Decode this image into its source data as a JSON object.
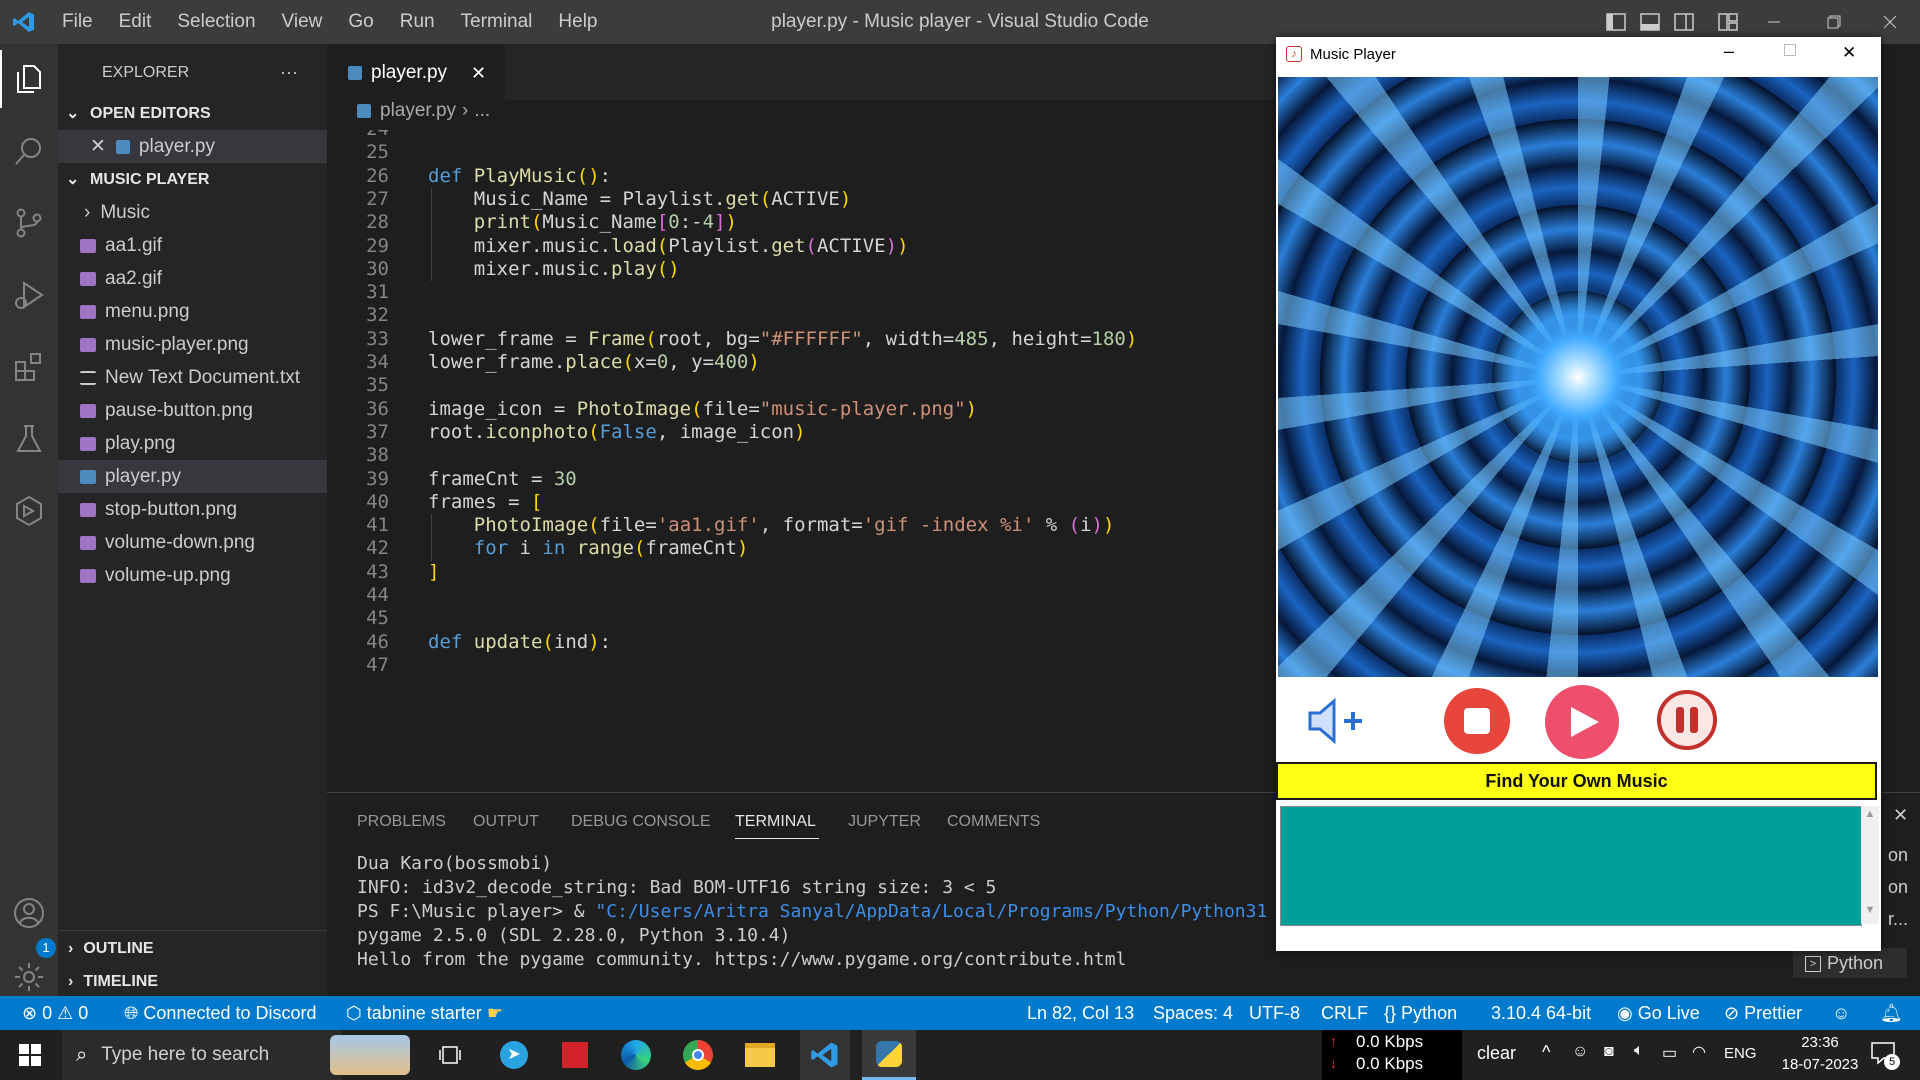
{
  "window_title": "player.py - Music player - Visual Studio Code",
  "menu": [
    "File",
    "Edit",
    "Selection",
    "View",
    "Go",
    "Run",
    "Terminal",
    "Help"
  ],
  "explorer": {
    "title": "EXPLORER",
    "more": "···",
    "open_editors_label": "OPEN EDITORS",
    "open_editor_file": "player.py",
    "folder_label": "MUSIC PLAYER",
    "subfolder": "Music",
    "files": [
      {
        "name": "aa1.gif",
        "kind": "image"
      },
      {
        "name": "aa2.gif",
        "kind": "image"
      },
      {
        "name": "menu.png",
        "kind": "image"
      },
      {
        "name": "music-player.png",
        "kind": "image"
      },
      {
        "name": "New Text Document.txt",
        "kind": "text"
      },
      {
        "name": "pause-button.png",
        "kind": "image"
      },
      {
        "name": "play.png",
        "kind": "image"
      },
      {
        "name": "player.py",
        "kind": "python"
      },
      {
        "name": "stop-button.png",
        "kind": "image"
      },
      {
        "name": "volume-down.png",
        "kind": "image"
      },
      {
        "name": "volume-up.png",
        "kind": "image"
      }
    ],
    "outline_label": "OUTLINE",
    "timeline_label": "TIMELINE"
  },
  "editor": {
    "tab_label": "player.py",
    "breadcrumb_file": "player.py",
    "breadcrumb_more": "...",
    "lines": [
      {
        "n": "24",
        "text": ""
      },
      {
        "n": "25",
        "text": ""
      },
      {
        "n": "26",
        "text": "def PlayMusic():"
      },
      {
        "n": "27",
        "text": "    Music_Name = Playlist.get(ACTIVE)"
      },
      {
        "n": "28",
        "text": "    print(Music_Name[0:-4])"
      },
      {
        "n": "29",
        "text": "    mixer.music.load(Playlist.get(ACTIVE))"
      },
      {
        "n": "30",
        "text": "    mixer.music.play()"
      },
      {
        "n": "31",
        "text": ""
      },
      {
        "n": "32",
        "text": ""
      },
      {
        "n": "33",
        "text": "lower_frame = Frame(root, bg=\"#FFFFFF\", width=485, height=180)"
      },
      {
        "n": "34",
        "text": "lower_frame.place(x=0, y=400)"
      },
      {
        "n": "35",
        "text": ""
      },
      {
        "n": "36",
        "text": "image_icon = PhotoImage(file=\"music-player.png\")"
      },
      {
        "n": "37",
        "text": "root.iconphoto(False, image_icon)"
      },
      {
        "n": "38",
        "text": ""
      },
      {
        "n": "39",
        "text": "frameCnt = 30"
      },
      {
        "n": "40",
        "text": "frames = ["
      },
      {
        "n": "41",
        "text": "    PhotoImage(file='aa1.gif', format='gif -index %i' % (i))"
      },
      {
        "n": "42",
        "text": "    for i in range(frameCnt)"
      },
      {
        "n": "43",
        "text": "]"
      },
      {
        "n": "44",
        "text": ""
      },
      {
        "n": "45",
        "text": ""
      },
      {
        "n": "46",
        "text": "def update(ind):"
      },
      {
        "n": "47",
        "text": ""
      }
    ]
  },
  "panel": {
    "tabs": [
      "PROBLEMS",
      "OUTPUT",
      "DEBUG CONSOLE",
      "TERMINAL",
      "JUPYTER",
      "COMMENTS"
    ],
    "active_tab": "TERMINAL",
    "terminal_lines": [
      "Dua Karo(bossmobi)",
      "INFO: id3v2_decode_string: Bad BOM-UTF16 string size: 3 < 5",
      "PS F:\\Music player> & \"C:/Users/Aritra Sanyal/AppData/Local/Programs/Python/Python31",
      "pygame 2.5.0 (SDL 2.28.0, Python 3.10.4)",
      "Hello from the pygame community. https://www.pygame.org/contribute.html"
    ],
    "side_fragments": [
      "on",
      "on",
      "r..."
    ],
    "python_label": "Python"
  },
  "statusbar": {
    "errors": "0",
    "warnings": "0",
    "discord": "Connected to Discord",
    "tabnine": "tabnine starter",
    "position": "Ln 82, Col 13",
    "spaces": "Spaces: 4",
    "encoding": "UTF-8",
    "eol": "CRLF",
    "language": "Python",
    "interpreter": "3.10.4 64-bit",
    "golive": "Go Live",
    "prettier": "Prettier",
    "accounts_badge": "1"
  },
  "music_player": {
    "title": "Music Player",
    "find_button": "Find Your Own Music",
    "colors": {
      "find_bg": "#ffff14",
      "list_bg": "#009e9a",
      "stop": "#e8453c",
      "play": "#ee4f6d",
      "pause": "#c4302b",
      "volume": "#2a6fd6"
    }
  },
  "taskbar": {
    "search_placeholder": "Type here to search",
    "net_up": "0.0 Kbps",
    "net_down": "0.0 Kbps",
    "weather_text": "clear",
    "lang": "ENG",
    "time": "23:36",
    "date": "18-07-2023",
    "notif_count": "5"
  }
}
